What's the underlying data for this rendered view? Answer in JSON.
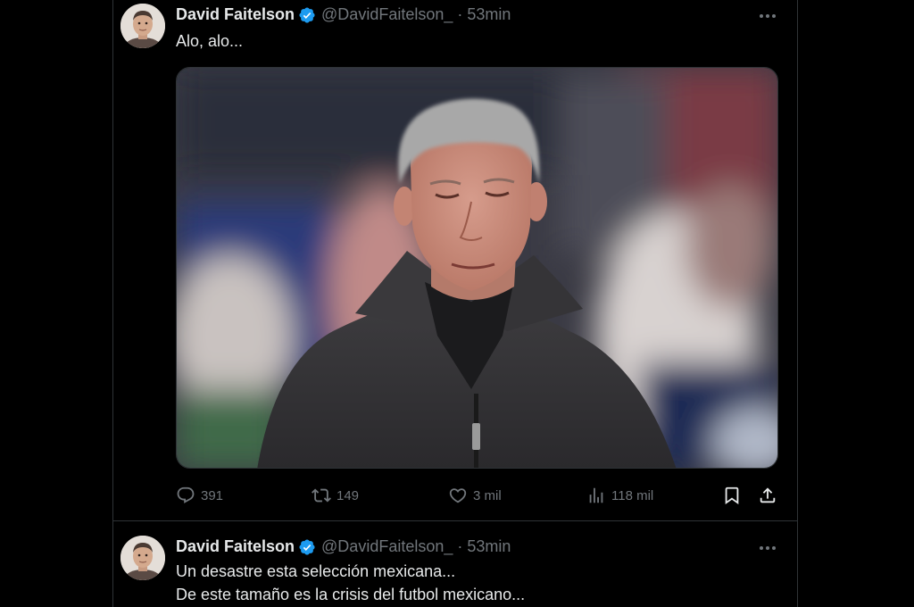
{
  "tweets": [
    {
      "author": {
        "name": "David Faitelson",
        "handle": "@DavidFaitelson_",
        "verified": true
      },
      "separator": "·",
      "time": "53min",
      "text_lines": [
        "Alo, alo..."
      ],
      "media": {
        "type": "photo",
        "alt": "Gray-haired man in a dark zip jacket looking down"
      },
      "stats": {
        "replies": "391",
        "retweets": "149",
        "likes": "3 mil",
        "views": "118 mil"
      }
    },
    {
      "author": {
        "name": "David Faitelson",
        "handle": "@DavidFaitelson_",
        "verified": true
      },
      "separator": "·",
      "time": "53min",
      "text_lines": [
        "Un desastre esta selección mexicana...",
        "De este tamaño es la crisis del futbol mexicano..."
      ]
    }
  ],
  "icons": {
    "verified": "verified-badge-icon",
    "more": "more-horizontal-icon",
    "reply": "reply-icon",
    "retweet": "retweet-icon",
    "like": "heart-icon",
    "views": "views-chart-icon",
    "bookmark": "bookmark-icon",
    "share": "share-icon"
  },
  "colors": {
    "background": "#000000",
    "text_primary": "#e7e9ea",
    "text_secondary": "#71767b",
    "verified_blue": "#1d9bf0",
    "border": "#2f3336"
  }
}
